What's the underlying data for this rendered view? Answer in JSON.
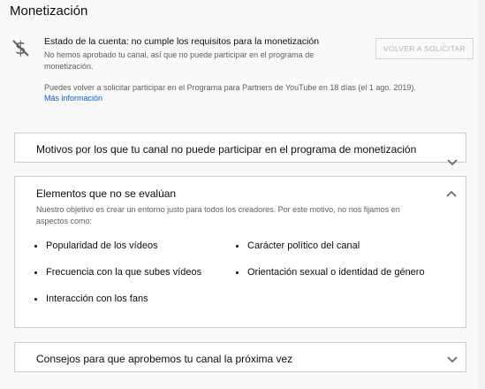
{
  "page": {
    "title": "Monetización"
  },
  "status": {
    "title": "Estado de la cuenta: no cumple los requisitos para la monetización",
    "description": "No hemos aprobado tu canal, así que no puede participar en el programa de monetización.",
    "reapply_button": "VOLVER A SOLICITAR",
    "reapply_note": "Puedes volver a solicitar participar en el Programa para Partners de YouTube en 18 días (el 1 ago. 2019).",
    "more_info": "Más información",
    "icon": "no-money-icon"
  },
  "panels": [
    {
      "title": "Motivos por los que tu canal no puede participar en el programa de monetización",
      "expanded": false
    },
    {
      "title": "Elementos que no se evalúan",
      "expanded": true,
      "description": "Nuestro objetivo es crear un entorno justo para todos los creadores. Por este motivo, no nos fijamos en aspectos como:",
      "items": [
        "Popularidad de los vídeos",
        "Carácter político del canal",
        "Frecuencia con la que subes vídeos",
        "Orientación sexual o identidad de género",
        "Interacción con los fans"
      ]
    },
    {
      "title": "Consejos para que aprobemos tu canal la próxima vez",
      "expanded": false
    }
  ],
  "colors": {
    "link": "#065fd4",
    "border": "#cfcfcf",
    "secondary_text": "#606060"
  }
}
